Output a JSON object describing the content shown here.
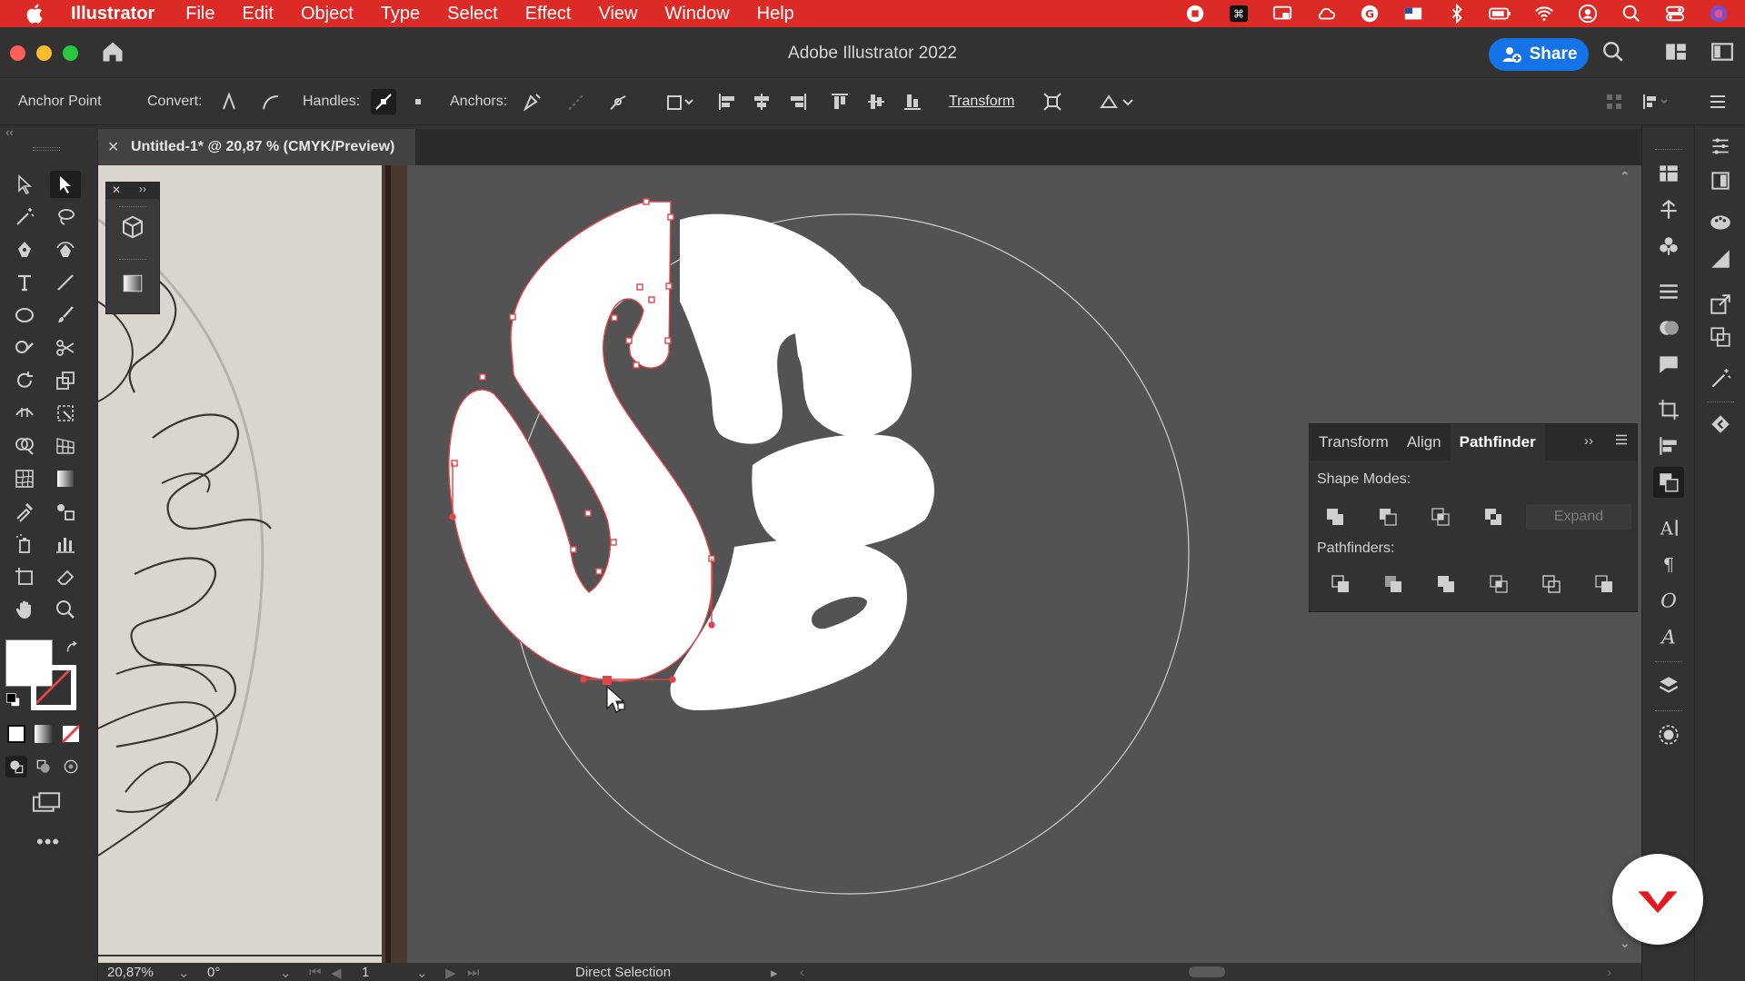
{
  "menubar": {
    "app_name": "Illustrator",
    "items": [
      "File",
      "Edit",
      "Object",
      "Type",
      "Select",
      "Effect",
      "View",
      "Window",
      "Help"
    ]
  },
  "window": {
    "title": "Adobe Illustrator 2022",
    "share_label": "Share"
  },
  "controlbar": {
    "tool_name": "Anchor Point",
    "convert_label": "Convert:",
    "handles_label": "Handles:",
    "anchors_label": "Anchors:",
    "transform_label": "Transform"
  },
  "document": {
    "tab_title": "Untitled-1* @ 20,87 % (CMYK/Preview)"
  },
  "pathfinder_panel": {
    "tabs": [
      "Transform",
      "Align",
      "Pathfinder"
    ],
    "active_tab": "Pathfinder",
    "shape_modes_label": "Shape Modes:",
    "pathfinders_label": "Pathfinders:",
    "expand_label": "Expand"
  },
  "statusbar": {
    "zoom": "20,87%",
    "rotation": "0°",
    "artboard": "1",
    "current_tool": "Direct Selection"
  },
  "colors": {
    "menubar": "#dc2b27",
    "accent": "#1473e6",
    "path_highlight": "#e0454a",
    "ui_dark": "#323232",
    "canvas": "#535353"
  }
}
